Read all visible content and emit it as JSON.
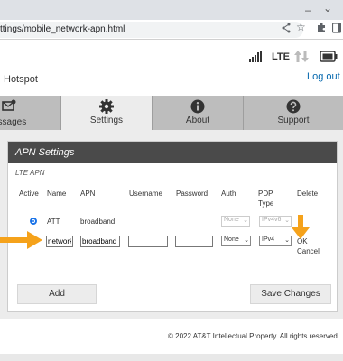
{
  "browser": {
    "url": "ttings/mobile_network-apn.html",
    "minimize_glyph": "–",
    "chevron_glyph": "⌄",
    "star_glyph": "☆"
  },
  "header": {
    "lte": "LTE",
    "title": "Hotspot",
    "logout": "Log out"
  },
  "nav": {
    "tabs": [
      {
        "label": "essages",
        "icon": "envelope-icon"
      },
      {
        "label": "Settings",
        "icon": "gear-icon"
      },
      {
        "label": "About",
        "icon": "info-icon"
      },
      {
        "label": "Support",
        "icon": "help-icon"
      }
    ]
  },
  "panel": {
    "title": "APN Settings",
    "section": "LTE APN",
    "columns": [
      "Active",
      "Name",
      "APN",
      "Username",
      "Password",
      "Auth",
      "PDP Type",
      "Delete"
    ],
    "rows": [
      {
        "name": "ATT",
        "apn": "broadband",
        "auth": "None",
        "pdp": "IPv4v6"
      },
      {
        "name": "network",
        "apn": "broadband",
        "username": "",
        "password": "",
        "auth": "None",
        "pdp": "IPv4",
        "ok": "OK",
        "cancel": "Cancel"
      }
    ],
    "add": "Add",
    "save": "Save Changes"
  },
  "footer": "© 2022 AT&T Intellectual Property. All rights reserved.",
  "colors": {
    "link": "#0568ae",
    "annotation": "#f5a21b",
    "panel_head": "#4a4a4a"
  }
}
